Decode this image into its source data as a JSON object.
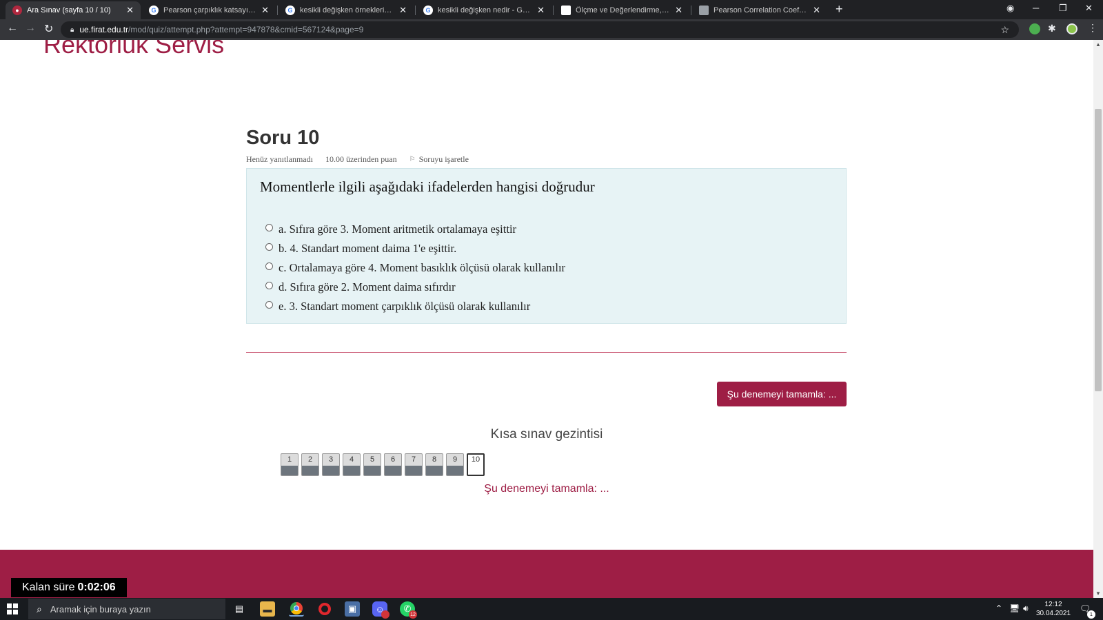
{
  "browser": {
    "tabs": [
      {
        "title": "Ara Sınav (sayfa 10 / 10)",
        "icon": "firat-favicon",
        "active": true
      },
      {
        "title": "Pearson çarpıklık katsayısı formül",
        "icon": "google-icon"
      },
      {
        "title": "kesikli değişken örnekleri - Goog",
        "icon": "google-icon"
      },
      {
        "title": "kesikli değişken nedir - Google'd",
        "icon": "google-icon"
      },
      {
        "title": "Ölçme ve Değerlendirme, Değişk",
        "icon": "document-icon"
      },
      {
        "title": "Pearson Correlation Coefficient C",
        "icon": "table-icon"
      }
    ],
    "close_glyph": "✕",
    "new_tab_glyph": "+",
    "url_host": "ue.firat.edu.tr",
    "url_path": "/mod/quiz/attempt.php?attempt=947878&cmid=567124&page=9"
  },
  "page": {
    "site_title": "Rektörlük Servis",
    "question_heading": "Soru 10",
    "status": "Henüz yanıtlanmadı",
    "points": "10.00 üzerinden puan",
    "flag_label": "Soruyu işaretle",
    "question_text": "Momentlerle ilgili aşağıdaki ifadelerden hangisi doğrudur",
    "answers": [
      "a. Sıfıra göre 3. Moment aritmetik ortalamaya eşittir",
      "b. 4. Standart moment daima 1'e eşittir.",
      "c. Ortalamaya göre 4. Moment basıklık ölçüsü olarak kullanılır",
      "d. Sıfıra göre 2. Moment daima sıfırdır",
      "e. 3. Standart moment çarpıklık ölçüsü olarak kullanılır"
    ],
    "finish_button": "Şu denemeyi tamamla: ...",
    "nav_title": "Kısa sınav gezintisi",
    "nav_numbers": [
      "1",
      "2",
      "3",
      "4",
      "5",
      "6",
      "7",
      "8",
      "9",
      "10"
    ],
    "current_question": "10",
    "finish_link": "Şu denemeyi tamamla: ...",
    "timer_label": "Kalan süre",
    "timer_value": "0:02:06"
  },
  "taskbar": {
    "search_placeholder": "Aramak için buraya yazın",
    "apps": [
      "task-view-icon",
      "file-explorer-icon",
      "chrome-icon",
      "opera-icon",
      "photos-icon",
      "discord-icon",
      "whatsapp-icon"
    ],
    "whatsapp_badge": "12",
    "clock_time": "12:12",
    "clock_date": "30.04.2021",
    "notification_count": "1"
  },
  "colors": {
    "brand": "#9e1e45",
    "question_bg": "#e7f3f5"
  }
}
